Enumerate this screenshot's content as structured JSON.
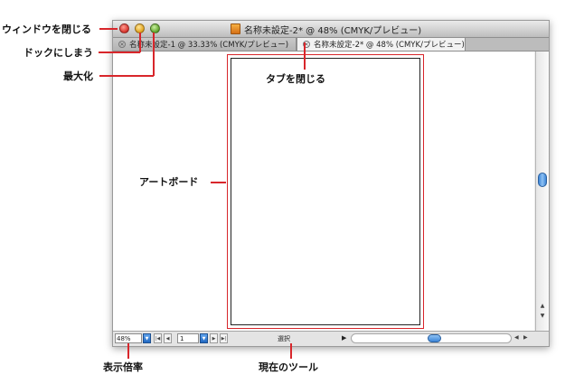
{
  "window": {
    "title": "名称未設定-2* @ 48% (CMYK/プレビュー)",
    "tabs": [
      {
        "label": "名称未設定-1 @ 33.33% (CMYK/プレビュー)"
      },
      {
        "label": "名称未設定-2* @ 48% (CMYK/プレビュー)"
      }
    ],
    "status": {
      "zoom": "48%",
      "page": "1",
      "tool": "選択"
    }
  },
  "annotations": {
    "close_window": "ウィンドウを閉じる",
    "dock": "ドックにしまう",
    "maximize": "最大化",
    "close_tab": "タブを閉じる",
    "artboard": "アートボード",
    "zoom_level": "表示倍率",
    "current_tool": "現在のツール"
  },
  "icons": {
    "traffic_close": "close-icon",
    "traffic_dock": "minimize-icon",
    "traffic_max": "maximize-icon",
    "doc": "document-icon"
  },
  "colors": {
    "annotation_line": "#d8262b",
    "scroll_thumb": "#3d86d8"
  }
}
